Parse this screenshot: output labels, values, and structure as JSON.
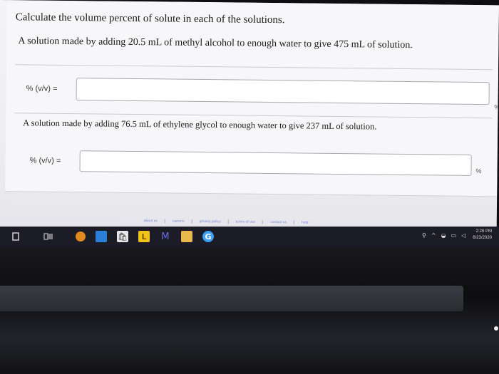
{
  "question": {
    "title": "Calculate the volume percent of solute in each of the solutions.",
    "part_a": {
      "prompt": "A solution made by adding 20.5 mL of methyl alcohol to enough water to give 475 mL of solution.",
      "label": "% (v/v) =",
      "value": "",
      "unit": "%"
    },
    "part_b": {
      "prompt": "A solution made by adding 76.5 mL of ethylene glycol to enough water to give 237 mL of solution.",
      "label": "% (v/v) =",
      "value": "",
      "unit": "%"
    }
  },
  "footer": {
    "links": [
      "about us",
      "careers",
      "privacy policy",
      "terms of use",
      "contact us",
      "help"
    ]
  },
  "taskbar": {
    "icons": [
      "windows-start-icon",
      "task-view-icon",
      "orange-app-icon",
      "mail-icon",
      "store-icon",
      "launcher-L-icon",
      "m-app-icon",
      "file-explorer-icon",
      "chrome-icon"
    ],
    "store_glyph": "🛍",
    "launcher_glyph": "L",
    "m_glyph": "M",
    "chrome_glyph": "G",
    "clock_time": "2:26 PM",
    "clock_date": "6/23/2020"
  }
}
